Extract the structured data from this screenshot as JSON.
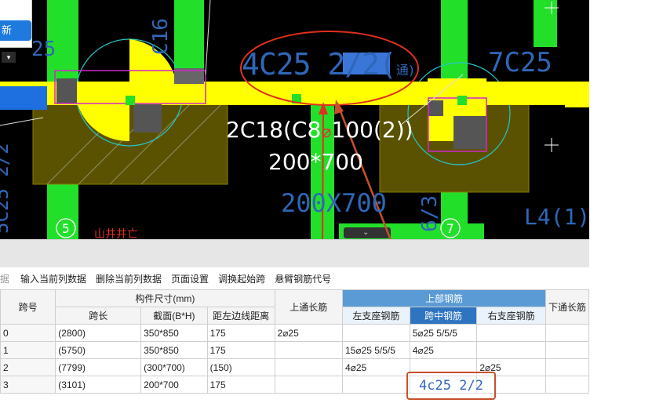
{
  "dialog": {
    "button_label": "新"
  },
  "cad": {
    "main_annotation": "4C25 2/2(",
    "main_annotation_suffix": "通)",
    "mid_label_1": "2C18(C8",
    "mid_label_1b": "100(2))",
    "mid_label_2": "200*700",
    "ghost_label": "200X700",
    "left_vertical": "5C25 2/2",
    "right_top": "7C25",
    "right_vertical": "6/3",
    "right_box": "L4(1)",
    "axis_5": "5",
    "axis_7": "7",
    "small_top": "25",
    "vert_top": "C16",
    "red_text": "山井井亡"
  },
  "toolbar": {
    "items": [
      "输入当前列数据",
      "删除当前列数据",
      "页面设置",
      "调换起始跨",
      "悬臂钢筋代号"
    ],
    "cut_item": "据"
  },
  "table": {
    "headers": {
      "span_no": "跨号",
      "member_size": "构件尺寸(mm)",
      "span_len": "跨长",
      "section": "截面(B*H)",
      "edge_dist": "距左边线距离",
      "top_through": "上通长筋",
      "top_rebar": "上部钢筋",
      "left_support": "左支座钢筋",
      "mid_span": "跨中钢筋",
      "right_support": "右支座钢筋",
      "bottom_through": "下通长筋"
    },
    "rows": [
      {
        "span": "0",
        "len": "(2800)",
        "sec": "350*850",
        "dist": "175",
        "top": "2⌀25",
        "left": "",
        "mid": "5⌀25 5/5/5",
        "right": ""
      },
      {
        "span": "1",
        "len": "(5750)",
        "sec": "350*850",
        "dist": "175",
        "top": "",
        "left": "15⌀25 5/5/5",
        "mid": "4⌀25",
        "right": ""
      },
      {
        "span": "2",
        "len": "(7799)",
        "sec": "(300*700)",
        "dist": "(150)",
        "top": "",
        "left": "4⌀25",
        "mid": "",
        "right": "2⌀25"
      },
      {
        "span": "3",
        "len": "(3101)",
        "sec": "200*700",
        "dist": "175",
        "top": "",
        "left": "",
        "mid": "",
        "right": ""
      }
    ]
  },
  "callout": {
    "text": "4c25 2/2"
  },
  "colors": {
    "beam_yellow": "#ffff00",
    "column_green": "#22e02a",
    "annotation_red": "#e0301e",
    "cad_blue": "#2f67b8"
  }
}
